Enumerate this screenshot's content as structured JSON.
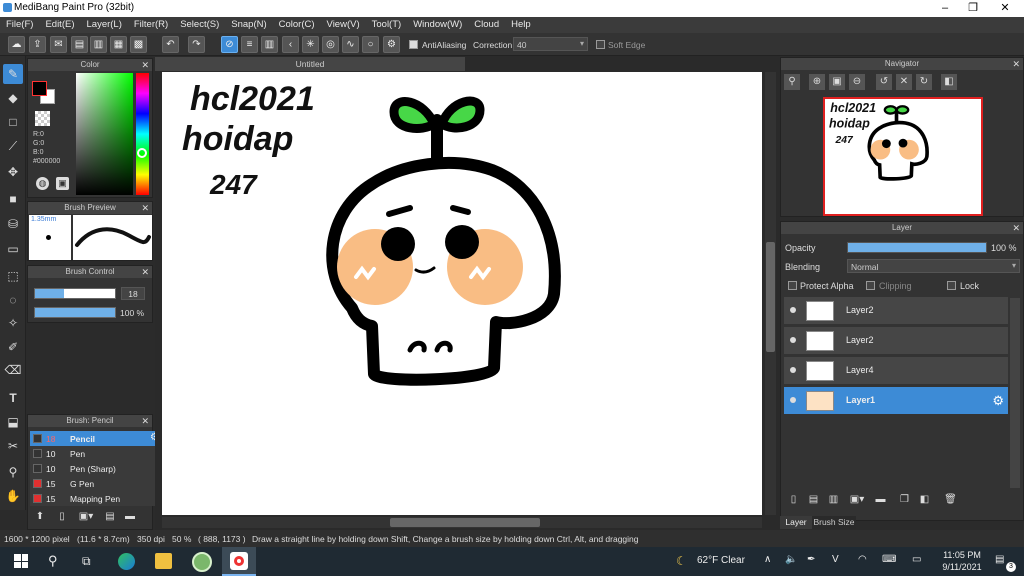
{
  "app": {
    "title": "MediBang Paint Pro (32bit)"
  },
  "menu": [
    "File(F)",
    "Edit(E)",
    "Layer(L)",
    "Filter(R)",
    "Select(S)",
    "Snap(N)",
    "Color(C)",
    "View(V)",
    "Tool(T)",
    "Window(W)",
    "Cloud",
    "Help"
  ],
  "toolbar": {
    "antialias_label": "AntiAliasing",
    "correction_label": "Correction",
    "correction_value": "40",
    "soft_edge_label": "Soft Edge"
  },
  "color_panel": {
    "title": "Color",
    "r": "R:0",
    "g": "G:0",
    "b": "B:0",
    "hex": "#000000",
    "fg": "#000000"
  },
  "brush_preview": {
    "title": "Brush Preview",
    "size": "1.35mm"
  },
  "brush_control": {
    "title": "Brush Control",
    "size": "18",
    "opacity": "100 %"
  },
  "brush_list": {
    "title": "Brush: Pencil",
    "items": [
      {
        "size": "18",
        "name": "Pencil",
        "color": "#333333",
        "selected": true
      },
      {
        "size": "10",
        "name": "Pen",
        "color": "#333333"
      },
      {
        "size": "10",
        "name": "Pen (Sharp)",
        "color": "#333333"
      },
      {
        "size": "15",
        "name": "G Pen",
        "color": "#e03030"
      },
      {
        "size": "15",
        "name": "Mapping Pen",
        "color": "#e03030"
      }
    ]
  },
  "canvas": {
    "tab": "Untitled",
    "text_lines": [
      "hcl2021",
      "hoidap",
      "247"
    ]
  },
  "navigator": {
    "title": "Navigator"
  },
  "layer_panel": {
    "title": "Layer",
    "opacity_label": "Opacity",
    "opacity_value": "100 %",
    "blending_label": "Blending",
    "blending_value": "Normal",
    "protect_alpha": "Protect Alpha",
    "clipping": "Clipping",
    "lock": "Lock",
    "layers": [
      {
        "name": "Layer2",
        "selected": false
      },
      {
        "name": "Layer2",
        "selected": false
      },
      {
        "name": "Layer4",
        "selected": false
      },
      {
        "name": "Layer1",
        "selected": true
      }
    ],
    "tabs": [
      "Layer",
      "Brush Size"
    ]
  },
  "status": {
    "size": "1600 * 1200 pixel",
    "dims": "(11.6 * 8.7cm)",
    "dpi": "350 dpi",
    "zoom": "50 %",
    "coords": "( 888, 1173 )",
    "hint": "Draw a straight line by holding down Shift, Change a brush size by holding down Ctrl, Alt, and dragging"
  },
  "taskbar": {
    "weather": "62°F  Clear",
    "time": "11:05 PM",
    "date": "9/11/2021",
    "notif_count": "3"
  },
  "colors": {
    "accent": "#3d8bd6",
    "blush": "#f9bd84",
    "sprout": "#47d747"
  }
}
